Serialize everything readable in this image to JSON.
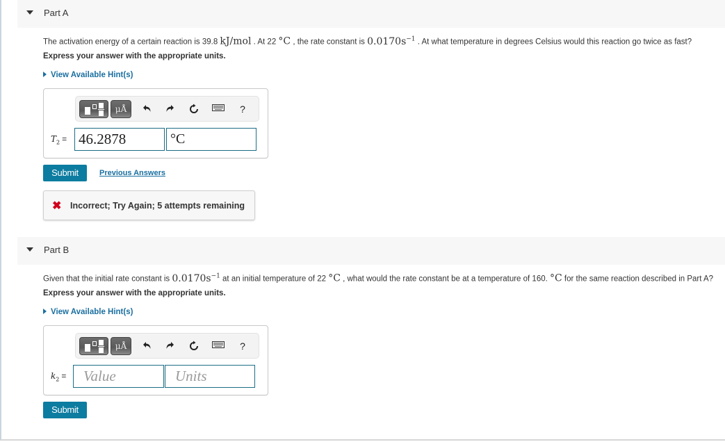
{
  "part_a": {
    "title": "Part A",
    "question": {
      "pre_energy": "The activation energy of a certain reaction is 39.8 ",
      "energy_unit": "kJ/mol",
      "pre_temp": " . At 22 ",
      "temp_unit": "°C",
      "pre_rate": " , the rate constant is ",
      "rate_value": "0.0170s",
      "rate_exp": "−1",
      "post": " . At what temperature in degrees Celsius would this reaction go twice as fast?"
    },
    "express": "Express your answer with the appropriate units.",
    "hint_label": "View Available Hint(s)",
    "variable": "T",
    "variable_sub": "2",
    "equals": "=",
    "value": "46.2878",
    "units": "°C",
    "submit_label": "Submit",
    "previous_answers_label": "Previous Answers",
    "feedback": {
      "status": "incorrect",
      "message": "Incorrect; Try Again; 5 attempts remaining",
      "color": "#d0021b"
    }
  },
  "part_b": {
    "title": "Part B",
    "question": {
      "pre_rate": "Given that the initial rate constant is ",
      "rate_value": "0.0170s",
      "rate_exp": "−1",
      "pre_temp": " at an initial temperature of 22 ",
      "temp_unit": "°C",
      "mid": " , what would the rate constant be at a temperature of 160. ",
      "temp_unit2": "°C",
      "post": " for the same reaction described in Part A?"
    },
    "express": "Express your answer with the appropriate units.",
    "hint_label": "View Available Hint(s)",
    "variable": "k",
    "variable_sub": "2",
    "equals": "=",
    "value_placeholder": "Value",
    "units_placeholder": "Units",
    "submit_label": "Submit"
  },
  "toolbar": {
    "units_label": "μÅ",
    "help_label": "?",
    "icons": [
      "templates-icon",
      "units-icon",
      "undo-icon",
      "redo-icon",
      "reset-icon",
      "keyboard-icon",
      "help-icon"
    ]
  },
  "colors": {
    "accent": "#0c7ca0",
    "link": "#1a6fa0",
    "field_border": "#1b6d86",
    "error": "#d0021b"
  }
}
